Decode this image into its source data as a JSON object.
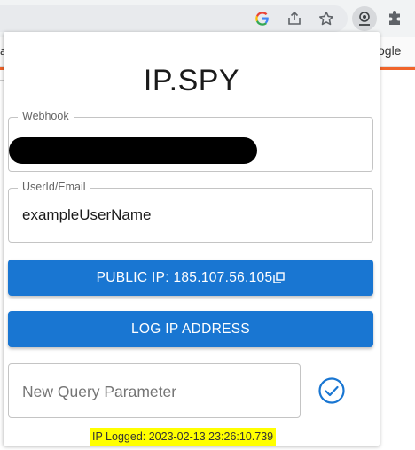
{
  "browser": {
    "left_text": "ai",
    "right_text": "ogle",
    "icons": [
      "google-icon",
      "share-icon",
      "bookmark-star-icon",
      "ip-spy-extension-icon",
      "extensions-puzzle-icon"
    ]
  },
  "popup": {
    "title": "IP.SPY",
    "webhook": {
      "label": "Webhook",
      "value_redacted": true
    },
    "userid": {
      "label": "UserId/Email",
      "value": "exampleUserName"
    },
    "public_ip_button": {
      "prefix": "PUBLIC IP: ",
      "ip": "185.107.56.105",
      "icon": "copy-icon"
    },
    "log_button": {
      "label": "LOG IP ADDRESS"
    },
    "query": {
      "placeholder": "New Query Parameter",
      "icon": "check-circle-icon"
    },
    "status": "IP Logged: 2023-02-13 23:26:10.739"
  },
  "colors": {
    "primary": "#1976d2",
    "highlight": "#ffff00",
    "accent_orange": "#f0642a"
  }
}
